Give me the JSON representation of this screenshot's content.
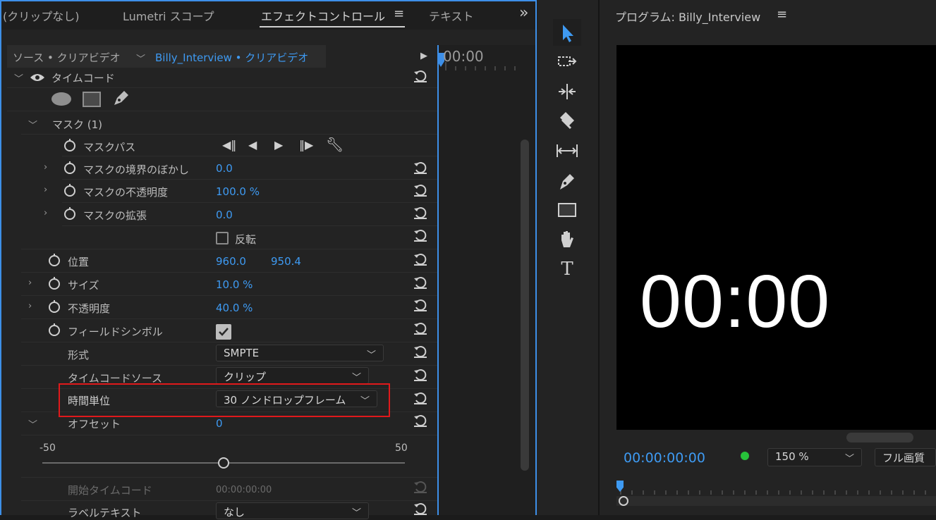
{
  "effect_panel": {
    "tabs": [
      {
        "label": "(クリップなし)"
      },
      {
        "label": "Lumetri スコープ"
      },
      {
        "label": "エフェクトコントロール"
      },
      {
        "label": "テキスト"
      }
    ],
    "more_label": "»",
    "source_label": "ソース • クリアビデオ",
    "clip_label": "Billy_Interview • クリアビデオ",
    "timeline_start": "00:00",
    "effect_name": "タイムコード",
    "mask_header": "マスク (1)",
    "mask_path_label": "マスクパス",
    "properties": {
      "mask_feather": {
        "label": "マスクの境界のぼかし",
        "value": "0.0"
      },
      "mask_opacity": {
        "label": "マスクの不透明度",
        "value": "100.0 %"
      },
      "mask_expansion": {
        "label": "マスクの拡張",
        "value": "0.0"
      },
      "inverted": {
        "label": "反転",
        "checked": false
      },
      "position": {
        "label": "位置",
        "x": "960.0",
        "y": "950.4"
      },
      "size": {
        "label": "サイズ",
        "value": "10.0 %"
      },
      "opacity": {
        "label": "不透明度",
        "value": "40.0 %"
      },
      "field_symbol": {
        "label": "フィールドシンボル",
        "checked": true
      },
      "format": {
        "label": "形式",
        "value": "SMPTE"
      },
      "timecode_source": {
        "label": "タイムコードソース",
        "value": "クリップ"
      },
      "time_units": {
        "label": "時間単位",
        "value": "30 ノンドロップフレーム"
      },
      "offset": {
        "label": "オフセット",
        "value": "0",
        "min": "-50",
        "max": "50",
        "level": 0.5
      },
      "start_timecode": {
        "label": "開始タイムコード",
        "value": "00:00:00:00"
      },
      "label_text": {
        "label": "ラベルテキスト",
        "value": "なし"
      }
    }
  },
  "tools": [
    "selection-tool",
    "track-select-tool",
    "ripple-edit-tool",
    "razor-tool",
    "slip-tool",
    "pen-tool",
    "rectangle-tool",
    "hand-tool",
    "type-tool"
  ],
  "tool_labels": {
    "type": "T"
  },
  "program_monitor": {
    "title": "プログラム: Billy_Interview",
    "menu_icon": "≡",
    "display_timecode": "00:00",
    "current_time": "00:00:00:00",
    "zoom": "150 %",
    "quality": "フル画質",
    "status_color": "#27c13a"
  },
  "colors": {
    "accent": "#3e9af2",
    "highlight": "#e0191b"
  }
}
